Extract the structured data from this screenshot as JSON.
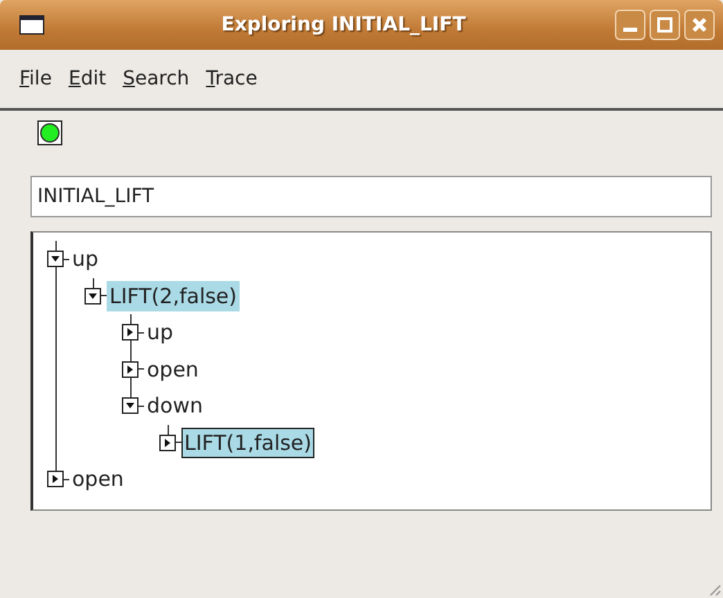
{
  "window": {
    "title": "Exploring INITIAL_LIFT"
  },
  "menu": [
    {
      "label": "File"
    },
    {
      "label": "Edit"
    },
    {
      "label": "Search"
    },
    {
      "label": "Trace"
    }
  ],
  "status_light": {
    "on": true
  },
  "state_field": {
    "value": "INITIAL_LIFT"
  },
  "tree": {
    "nodes": [
      {
        "label": "up",
        "expanded": true,
        "selected": false,
        "focused": false,
        "children": [
          {
            "label": "LIFT(2,false)",
            "expanded": true,
            "selected": true,
            "focused": false,
            "children": [
              {
                "label": "up",
                "expanded": false,
                "selected": false,
                "focused": false
              },
              {
                "label": "open",
                "expanded": false,
                "selected": false,
                "focused": false
              },
              {
                "label": "down",
                "expanded": true,
                "selected": false,
                "focused": false,
                "children": [
                  {
                    "label": "LIFT(1,false)",
                    "expanded": false,
                    "selected": true,
                    "focused": true
                  }
                ]
              }
            ]
          }
        ]
      },
      {
        "label": "open",
        "expanded": false,
        "selected": false,
        "focused": false
      }
    ]
  }
}
